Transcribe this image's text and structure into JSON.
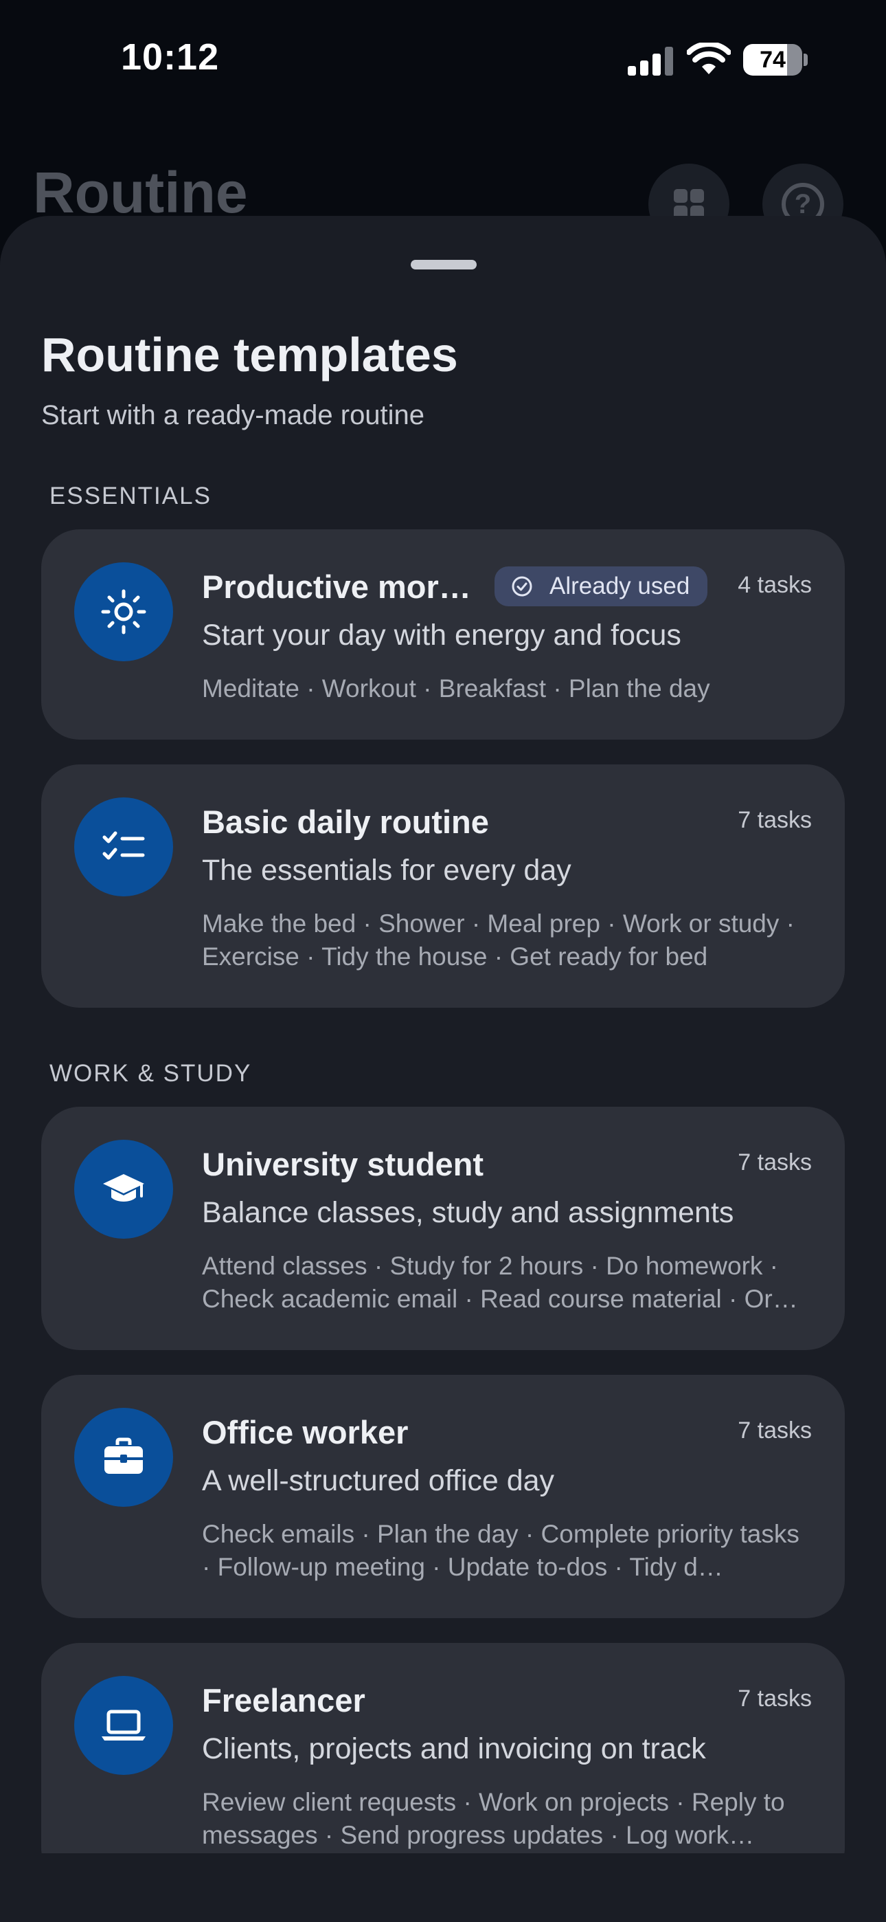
{
  "status_bar": {
    "time": "10:12",
    "battery": "74",
    "battery_fraction": 0.74
  },
  "background": {
    "title": "Routine",
    "grid_icon": "grid-icon",
    "help_icon": "help-icon"
  },
  "sheet": {
    "title": "Routine templates",
    "subtitle": "Start with a ready-made routine",
    "sections": [
      {
        "label": "ESSENTIALS",
        "templates": [
          {
            "icon": "sun-icon",
            "title": "Productive mor…",
            "badge": "Already used",
            "count": "4 tasks",
            "description": "Start your day with energy and focus",
            "tasks": "Meditate · Workout · Breakfast · Plan the day"
          },
          {
            "icon": "checklist-icon",
            "title": "Basic daily routine",
            "count": "7 tasks",
            "description": "The essentials for every day",
            "tasks": "Make the bed · Shower · Meal prep · Work or study · Exercise · Tidy the house · Get ready for bed"
          }
        ]
      },
      {
        "label": "WORK & STUDY",
        "templates": [
          {
            "icon": "graduation-cap-icon",
            "title": "University student",
            "count": "7 tasks",
            "description": "Balance classes, study and assignments",
            "tasks": "Attend classes · Study for 2 hours · Do homework · Check academic email · Read course material · Or…"
          },
          {
            "icon": "briefcase-icon",
            "title": "Office worker",
            "count": "7 tasks",
            "description": "A well-structured office day",
            "tasks": "Check emails · Plan the day · Complete priority tasks · Follow-up meeting · Update to-dos · Tidy d…"
          },
          {
            "icon": "laptop-icon",
            "title": "Freelancer",
            "count": "7 tasks",
            "description": "Clients, projects and invoicing on track",
            "tasks": "Review client requests · Work on projects · Reply to messages · Send progress updates · Log work…"
          }
        ]
      }
    ]
  },
  "colors": {
    "sheet_bg": "#1a1d25",
    "card_bg": "#2d3039",
    "icon_bg": "#0a4f9a",
    "badge_bg": "#3e4866"
  }
}
